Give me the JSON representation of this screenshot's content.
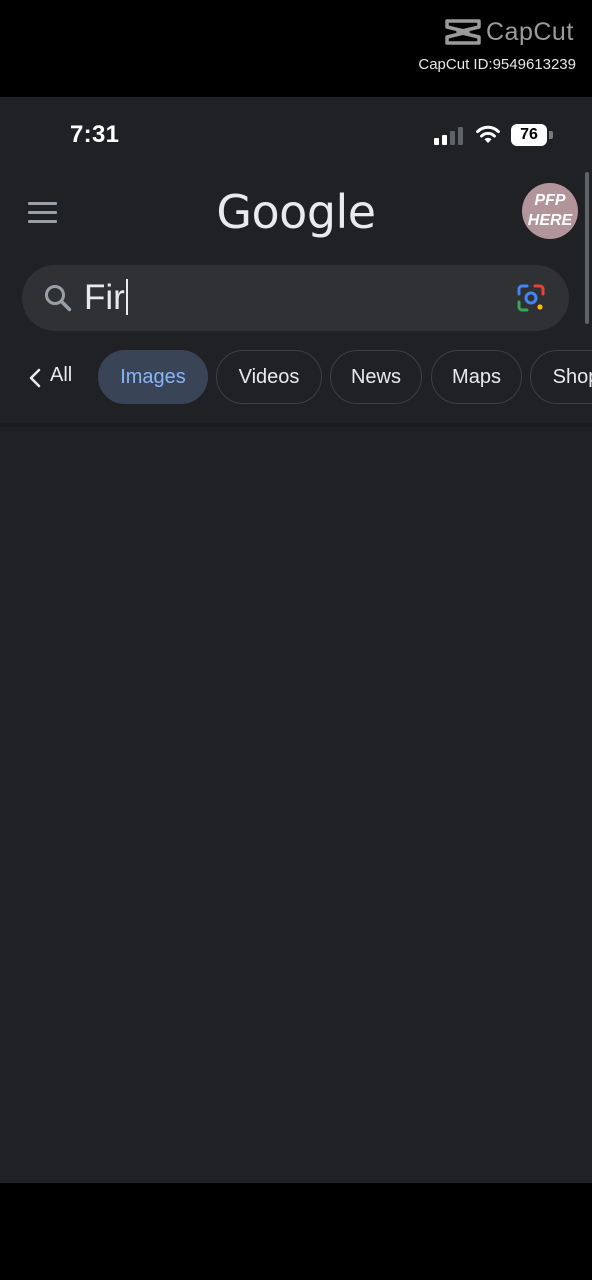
{
  "watermark": {
    "brand": "CapCut",
    "id_text": "CapCut ID:9549613239"
  },
  "status_bar": {
    "time": "7:31",
    "battery": "76",
    "icons": [
      "cellular-signal-icon",
      "wifi-icon",
      "battery-icon"
    ]
  },
  "header": {
    "logo_text": "Google",
    "avatar_line1": "PFP",
    "avatar_line2": "HERE",
    "icons": [
      "hamburger-menu-icon"
    ]
  },
  "search": {
    "query": "Fir",
    "icons": [
      "search-icon",
      "google-lens-icon"
    ]
  },
  "filters": {
    "back_label": "All",
    "chips": [
      {
        "label": "Images",
        "active": true
      },
      {
        "label": "Videos",
        "active": false
      },
      {
        "label": "News",
        "active": false
      },
      {
        "label": "Maps",
        "active": false
      },
      {
        "label": "Shop",
        "active": false
      }
    ]
  },
  "colors": {
    "screen_bg": "#202124",
    "search_bg": "#303134",
    "active_chip_bg": "#394457",
    "active_chip_text": "#8ab4f8",
    "text": "#e8eaed",
    "icon_gray": "#9aa0a6",
    "avatar_bg": "#b1959b"
  }
}
